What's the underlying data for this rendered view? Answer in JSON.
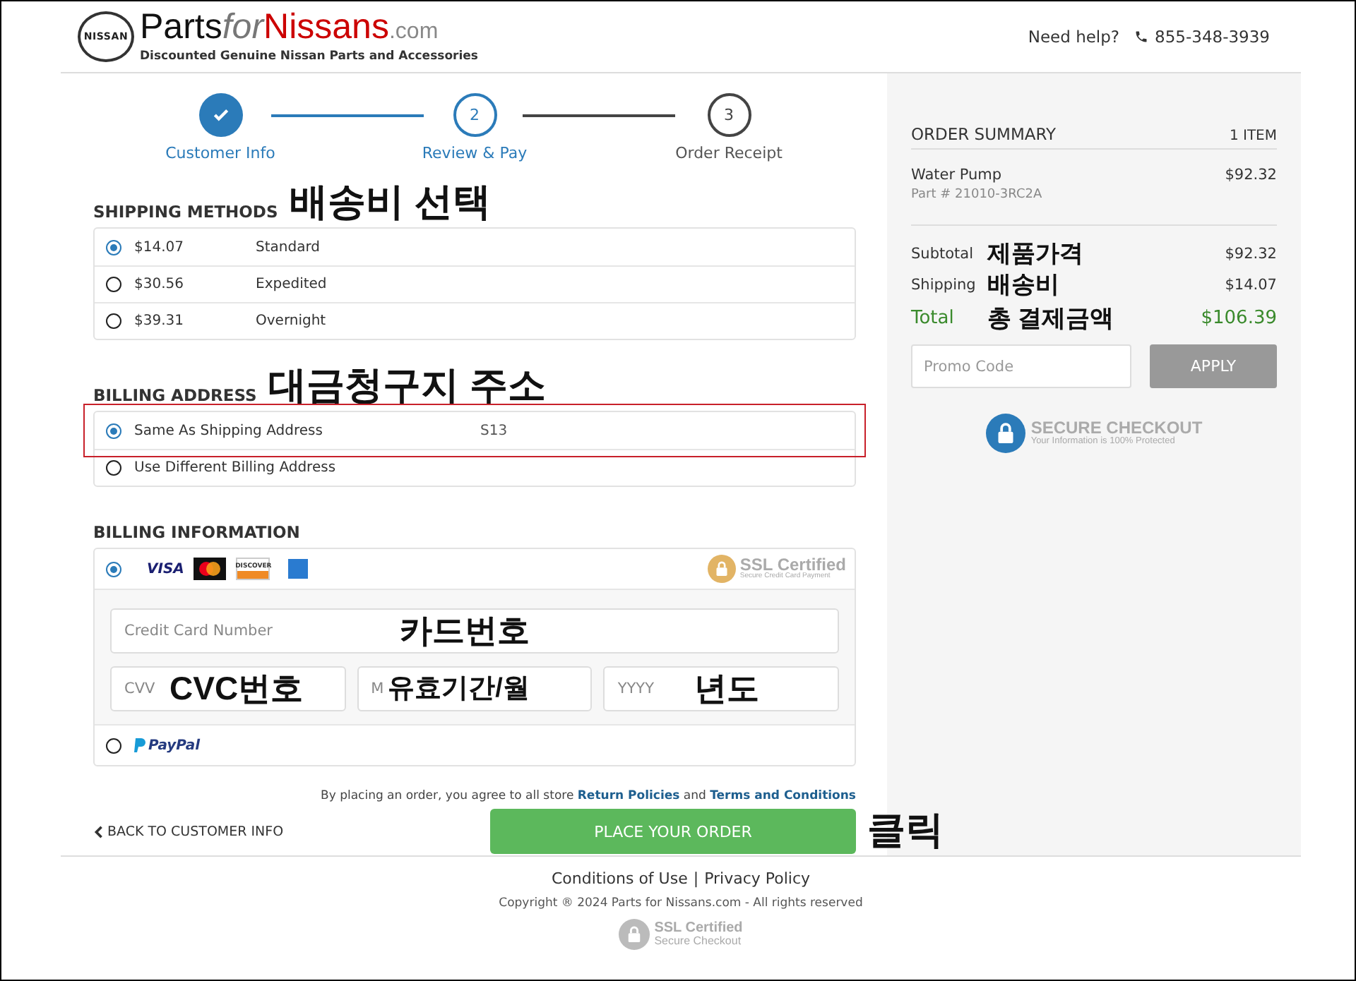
{
  "header": {
    "emblem": "NISSAN",
    "brand": [
      {
        "text": "Parts",
        "kind": "plain"
      },
      {
        "text": "for",
        "kind": "italic"
      },
      {
        "text": "Nissans",
        "kind": "red"
      },
      {
        "text": ".com",
        "kind": "small"
      }
    ],
    "tagline": "Discounted Genuine Nissan Parts and Accessories",
    "help_label": "Need help?",
    "phone": "855-348-3939"
  },
  "steps": [
    {
      "label": "Customer Info",
      "completed": true,
      "active": true
    },
    {
      "label": "Review & Pay",
      "number": "2",
      "completed": false,
      "active": true
    },
    {
      "label": "Order Receipt",
      "number": "3",
      "completed": false,
      "active": false
    }
  ],
  "shipping": {
    "heading": "SHIPPING METHODS",
    "annotation": "배송비 선택",
    "options": [
      {
        "price": "$14.07",
        "name": "Standard",
        "selected": true
      },
      {
        "price": "$30.56",
        "name": "Expedited",
        "selected": false
      },
      {
        "price": "$39.31",
        "name": "Overnight",
        "selected": false
      }
    ]
  },
  "billing_address": {
    "heading": "BILLING ADDRESS",
    "annotation": "대금청구지 주소",
    "options": [
      {
        "label": "Same As Shipping Address",
        "detail": "S13",
        "selected": true,
        "highlighted": true
      },
      {
        "label": "Use Different Billing Address",
        "selected": false,
        "highlighted": false
      }
    ]
  },
  "billing_info": {
    "heading": "BILLING INFORMATION",
    "card": {
      "selected": true,
      "visa": "VISA",
      "discover": "DISCOVER",
      "ssl_title": "SSL Certified",
      "ssl_subtitle": "Secure Credit Card Payment",
      "fields": [
        {
          "placeholder": "Credit Card Number",
          "annotation": "카드번호",
          "kind": "full"
        },
        {
          "placeholder": "CVV",
          "annotation": "CVC번호",
          "kind": "third"
        },
        {
          "placeholder": "M",
          "annotation": "유효기간/월",
          "kind": "third"
        },
        {
          "placeholder": "YYYY",
          "annotation": "년도",
          "kind": "third"
        }
      ]
    },
    "paypal": {
      "selected": false,
      "label": "PayPal"
    }
  },
  "agreement": {
    "text": "By placing an order, you agree to all store",
    "link_1": "Return Policies",
    "joiner": "and",
    "link_2": "Terms and Conditions"
  },
  "back_link": "BACK TO CUSTOMER INFO",
  "place_order": {
    "label": "PLACE YOUR ORDER",
    "annotation": "클릭"
  },
  "summary": {
    "title": "ORDER SUMMARY",
    "count": "1 ITEM",
    "items": [
      {
        "name": "Water Pump",
        "part": "Part # 21010-3RC2A",
        "price": "$92.32"
      }
    ],
    "totals": [
      {
        "label": "Subtotal",
        "annotation": "제품가격",
        "value": "$92.32",
        "kind": "line"
      },
      {
        "label": "Shipping",
        "annotation": "배송비",
        "value": "$14.07",
        "kind": "line"
      },
      {
        "label": "Total",
        "annotation": "총 결제금액",
        "value": "$106.39",
        "kind": "total"
      }
    ],
    "promo_placeholder": "Promo Code",
    "apply": "APPLY",
    "secure_title": "SECURE CHECKOUT",
    "secure_subtitle": "Your Information is 100% Protected"
  },
  "footer": {
    "links": [
      "Conditions of Use",
      "Privacy Policy"
    ],
    "separator": "|",
    "copyright": "Copyright ® 2024 Parts for Nissans.com - All rights reserved",
    "ssl_title": "SSL Certified",
    "ssl_subtitle": "Secure Checkout"
  }
}
